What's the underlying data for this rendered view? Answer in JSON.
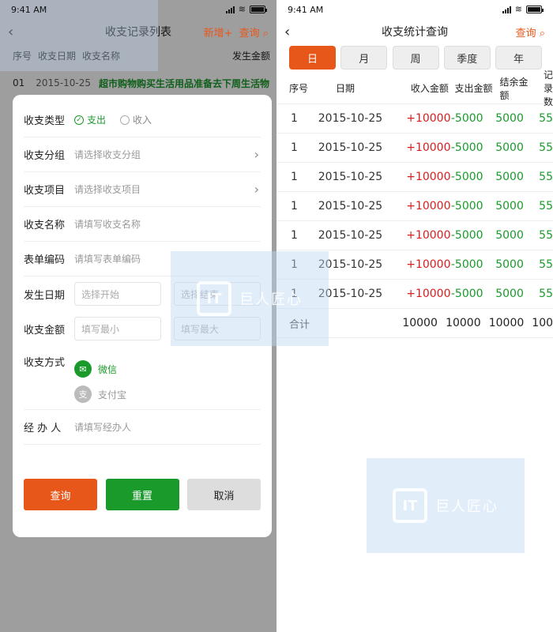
{
  "status": {
    "time": "9:41 AM"
  },
  "left": {
    "title": "收支记录列表",
    "add_label": "新增+",
    "query_label": "查询",
    "list_headers": [
      "序号",
      "收支日期",
      "收支名称",
      "发生金额"
    ],
    "bg_row": {
      "index": "01",
      "date": "2015-10-25",
      "name": "超市购物购买生活用品准备去下周生活物"
    },
    "form": {
      "type_label": "收支类型",
      "type_options": [
        "支出",
        "收入"
      ],
      "group_label": "收支分组",
      "group_ph": "请选择收支分组",
      "item_label": "收支项目",
      "item_ph": "请选择收支项目",
      "name_label": "收支名称",
      "name_ph": "请填写收支名称",
      "code_label": "表单编码",
      "code_ph": "请填写表单编码",
      "date_label": "发生日期",
      "date_start_ph": "选择开始",
      "date_end_ph": "选择结束",
      "amount_label": "收支金额",
      "amount_min_ph": "填写最小",
      "amount_max_ph": "填写最大",
      "pay_label": "收支方式",
      "pay_options": [
        "微信",
        "支付宝"
      ],
      "handler_label": "经 办 人",
      "handler_ph": "请填写经办人"
    },
    "buttons": {
      "query": "查询",
      "reset": "重置",
      "cancel": "取消"
    }
  },
  "right": {
    "title": "收支统计查询",
    "query_label": "查询",
    "tabs": [
      "日",
      "月",
      "周",
      "季度",
      "年"
    ],
    "headers": [
      "序号",
      "日期",
      "收入金额",
      "支出金额",
      "结余金额",
      "记录数"
    ],
    "rows": [
      [
        "1",
        "2015-10-25",
        "+10000",
        "-5000",
        "5000",
        "55"
      ],
      [
        "1",
        "2015-10-25",
        "+10000",
        "-5000",
        "5000",
        "55"
      ],
      [
        "1",
        "2015-10-25",
        "+10000",
        "-5000",
        "5000",
        "55"
      ],
      [
        "1",
        "2015-10-25",
        "+10000",
        "-5000",
        "5000",
        "55"
      ],
      [
        "1",
        "2015-10-25",
        "+10000",
        "-5000",
        "5000",
        "55"
      ],
      [
        "1",
        "2015-10-25",
        "+10000",
        "-5000",
        "5000",
        "55"
      ],
      [
        "1",
        "2015-10-25",
        "+10000",
        "-5000",
        "5000",
        "55"
      ]
    ],
    "total": [
      "合计",
      "10000",
      "10000",
      "10000",
      "100"
    ]
  },
  "watermark": {
    "logo": "IT",
    "text": "巨人匠心"
  },
  "colors": {
    "accent": "#e8571a",
    "green": "#1a9a2b",
    "red": "#d81e1e"
  }
}
